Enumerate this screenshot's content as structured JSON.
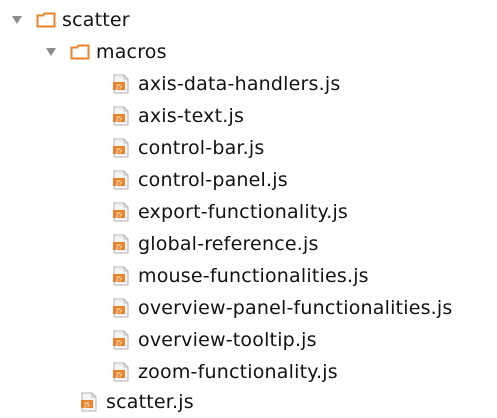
{
  "tree": {
    "root": {
      "name": "scatter",
      "expanded": true,
      "icon": "folder-icon"
    },
    "macros": {
      "name": "macros",
      "expanded": true,
      "icon": "folder-icon"
    },
    "macros_files": [
      "axis-data-handlers.js",
      "axis-text.js",
      "control-bar.js",
      "control-panel.js",
      "export-functionality.js",
      "global-reference.js",
      "mouse-functionalities.js",
      "overview-panel-functionalities.js",
      "overview-tooltip.js",
      "zoom-functionality.js"
    ],
    "root_files": [
      "scatter.js"
    ],
    "file_icon_text": "JS"
  },
  "colors": {
    "folder_orange": "#e8832a",
    "twisty_gray": "#8c8c8c",
    "js_icon_orange": "#e8832a",
    "js_icon_paper": "#f4f4f4"
  }
}
